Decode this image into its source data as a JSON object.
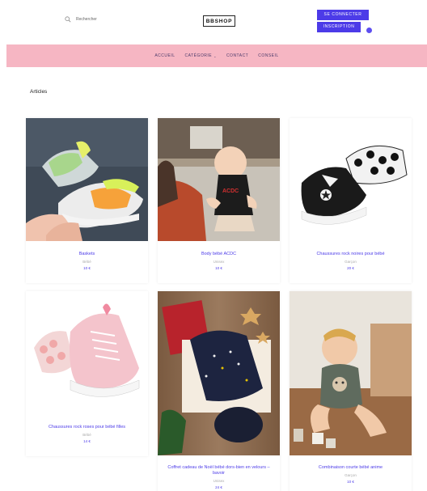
{
  "header": {
    "search_placeholder": "Rechercher",
    "logo": "BBSHOP",
    "login_label": "SE CONNECTER",
    "signup_label": "INSCRIPTION"
  },
  "nav": {
    "items": [
      {
        "label": "ACCUEIL",
        "has_dropdown": false
      },
      {
        "label": "CATÉGORIE",
        "has_dropdown": true
      },
      {
        "label": "CONTACT",
        "has_dropdown": false
      },
      {
        "label": "CONSEIL",
        "has_dropdown": false
      }
    ]
  },
  "main": {
    "section_title": "Articles",
    "products": [
      {
        "name": "Baskets",
        "category": "Bébé",
        "price": "10 €"
      },
      {
        "name": "Body bébé ACDC",
        "category": "Unisex",
        "price": "10 €"
      },
      {
        "name": "Chaussures rock noires pour bébé",
        "category": "Garçon",
        "price": "20 €"
      },
      {
        "name": "Chaussures rock roses pour bébé filles",
        "category": "Bébé",
        "price": "14 €"
      },
      {
        "name": "Coffret cadeau de Noël bébé dors-bien en velours – bavoir",
        "category": "Unisex",
        "price": "24 €"
      },
      {
        "name": "Combinaison courte bébé anime",
        "category": "Garçon",
        "price": "10 €"
      }
    ]
  },
  "colors": {
    "accent": "#4c3be8",
    "nav_bg": "#f6b6c3"
  }
}
